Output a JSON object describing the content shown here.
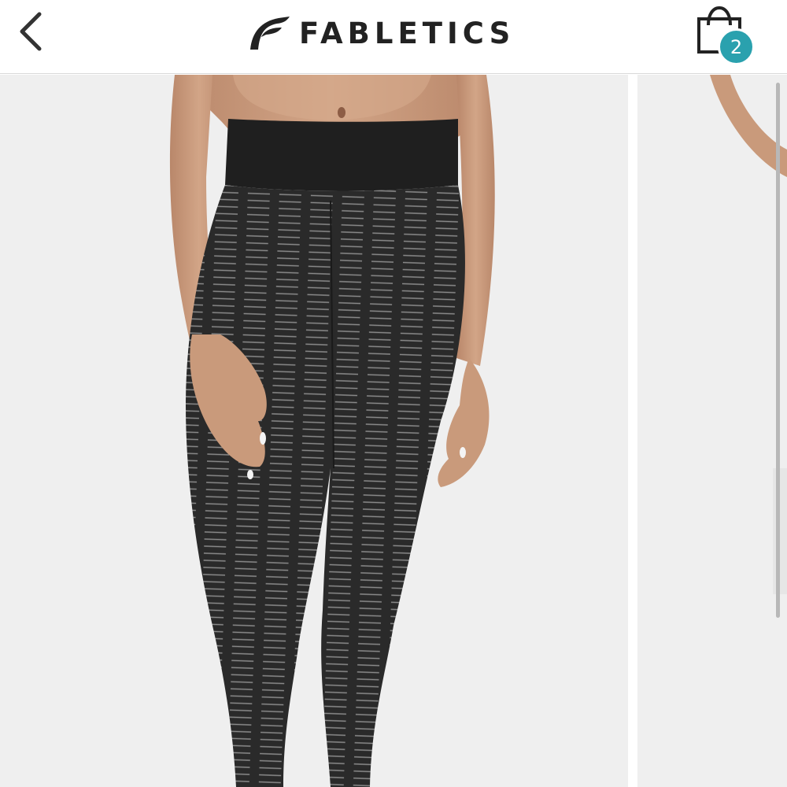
{
  "header": {
    "back_icon": "chevron-left-icon",
    "brand": "FABLETICS",
    "cart_icon": "shopping-bag-icon",
    "cart_count": "2"
  },
  "gallery": {
    "current_image": "product-photo-printed-capri-leggings",
    "next_image": "product-photo-side-view",
    "colors": {
      "background": "#efefef",
      "legging": "#2a2a2a",
      "stripe": "#8c8c8c",
      "skin": "#c99a7b",
      "badge": "#2aa1ae"
    }
  }
}
